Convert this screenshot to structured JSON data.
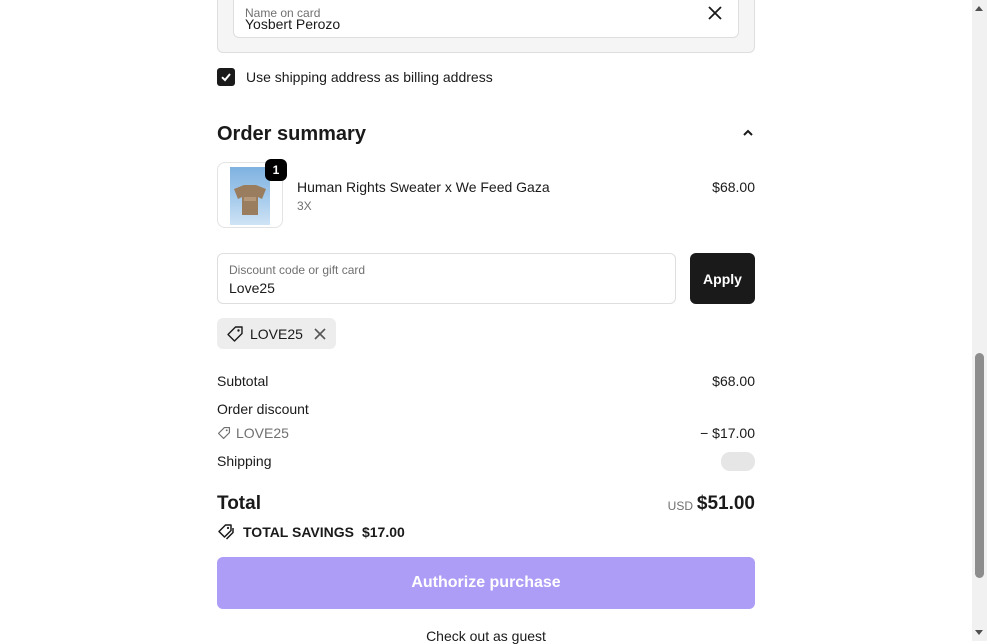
{
  "payment": {
    "name_label": "Name on card",
    "name_value": "Yosbert Perozo",
    "billing_same_label": "Use shipping address as billing address",
    "billing_same_checked": true
  },
  "order_summary": {
    "heading": "Order summary",
    "item": {
      "quantity": "1",
      "title": "Human Rights Sweater x We Feed Gaza",
      "variant": "3X",
      "price": "$68.00"
    },
    "discount_label": "Discount code or gift card",
    "discount_value": "Love25",
    "apply_label": "Apply",
    "applied_code": "LOVE25",
    "subtotal_label": "Subtotal",
    "subtotal_value": "$68.00",
    "order_discount_label": "Order discount",
    "discount_code_line": "LOVE25",
    "discount_amount": "− $17.00",
    "shipping_label": "Shipping",
    "total_label": "Total",
    "currency": "USD",
    "total_value": "$51.00",
    "savings_label": "TOTAL SAVINGS",
    "savings_value": "$17.00"
  },
  "actions": {
    "authorize_label": "Authorize purchase",
    "guest_label": "Check out as guest"
  },
  "colors": {
    "primary_button": "#ae9df6",
    "dark_button": "#1a1a1a"
  }
}
